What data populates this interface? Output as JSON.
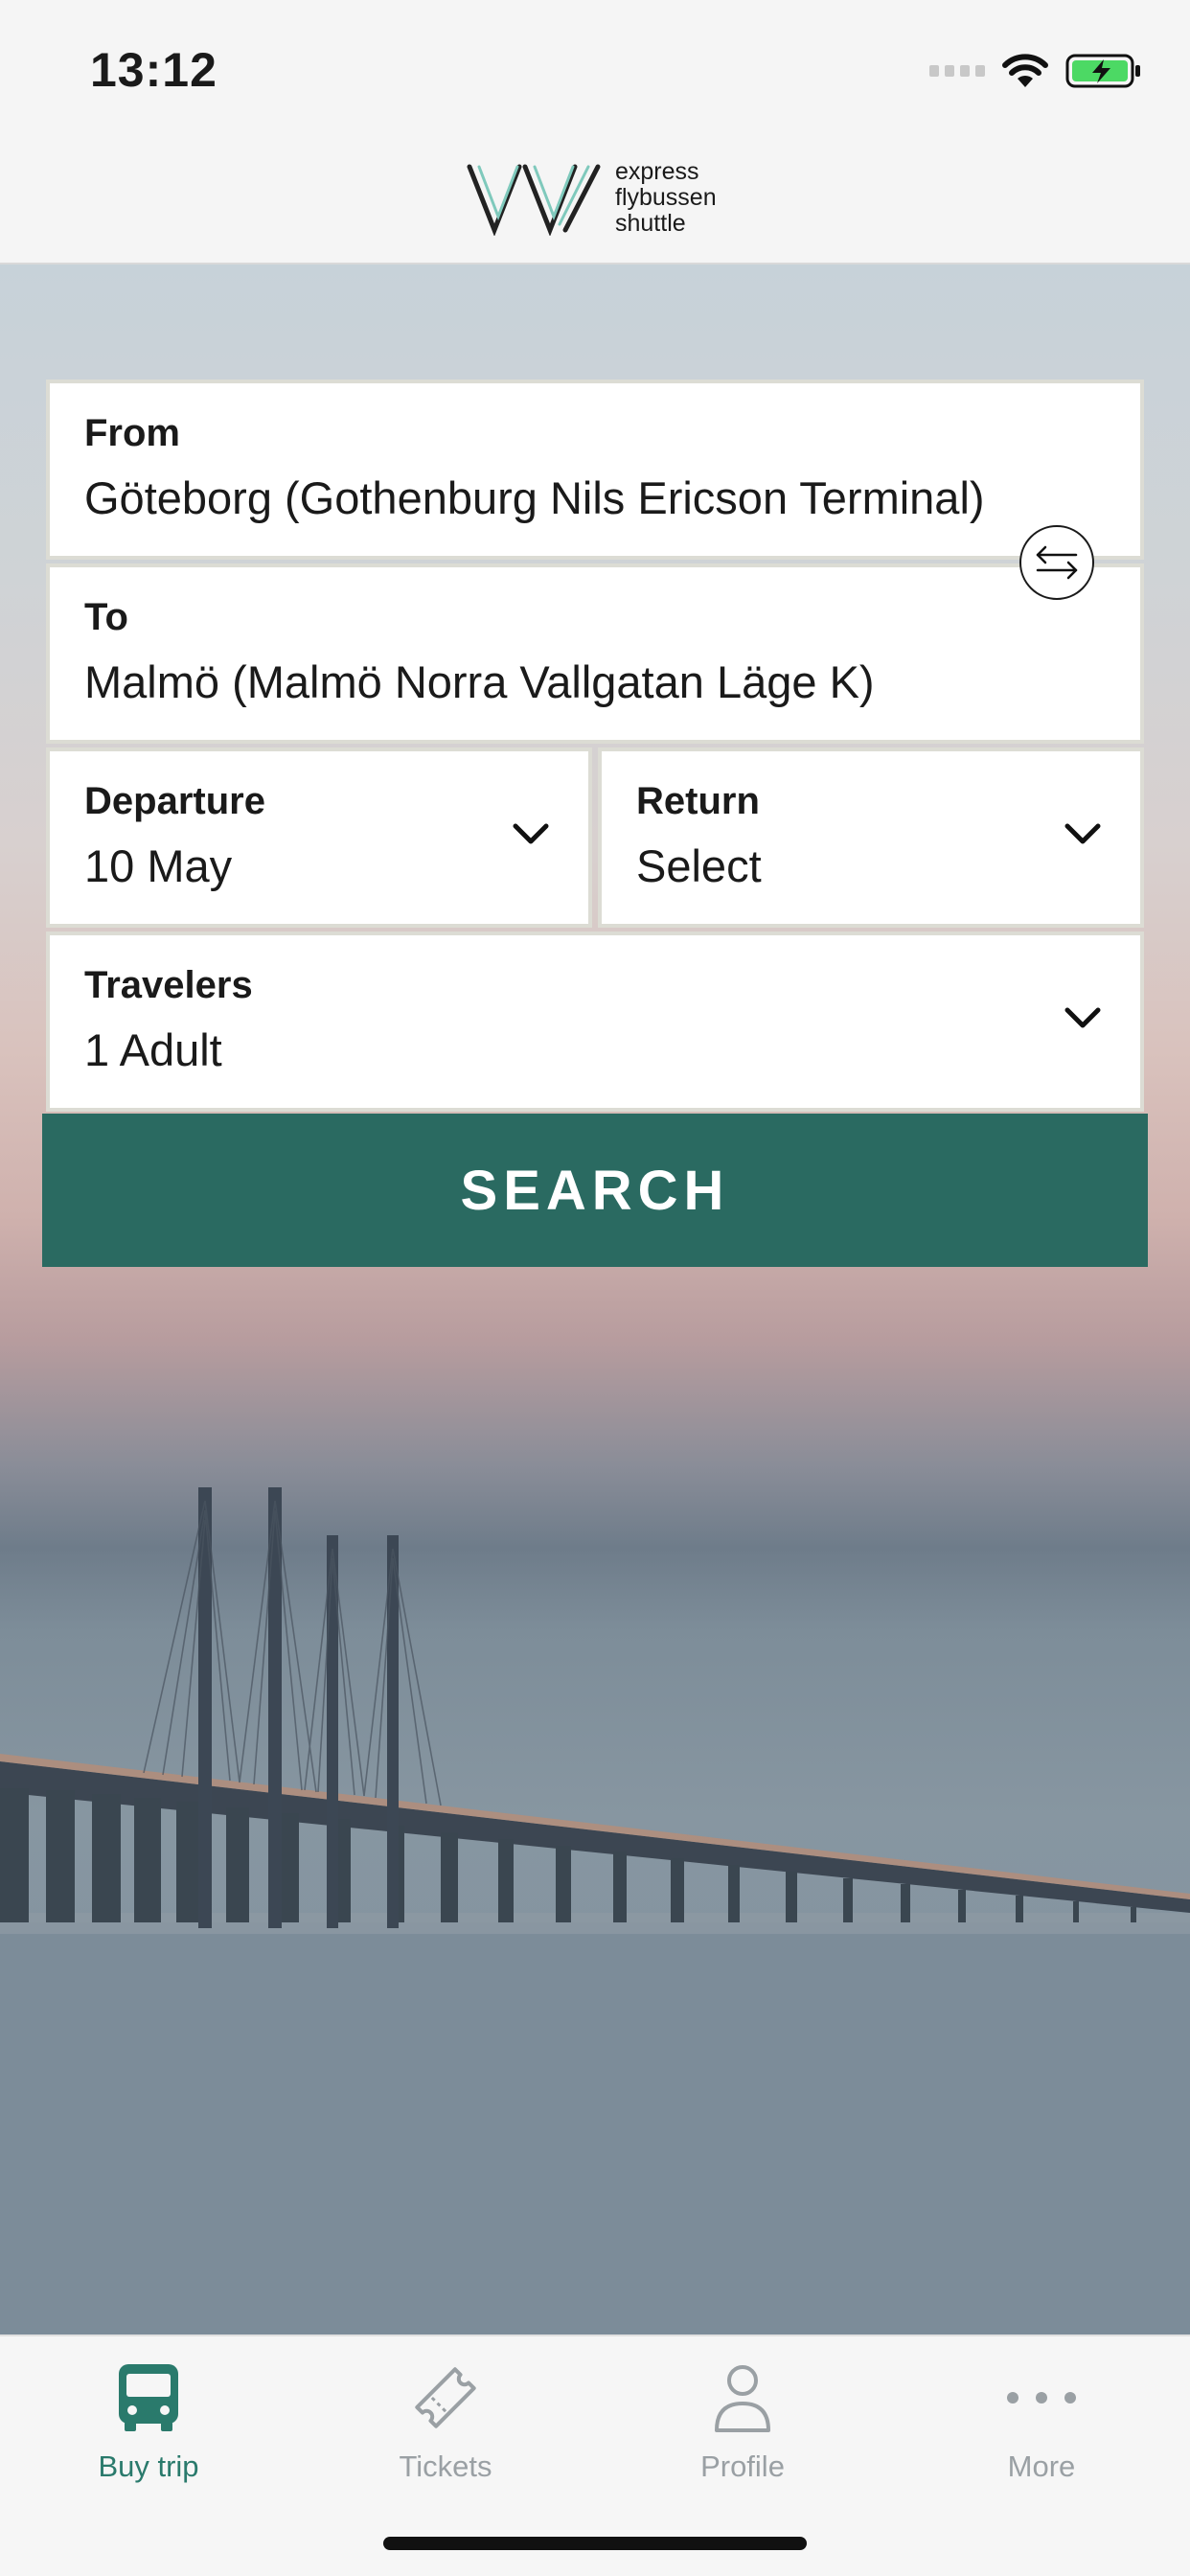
{
  "status": {
    "time": "13:12"
  },
  "brand": {
    "line1": "express",
    "line2": "flybussen",
    "line3": "shuttle"
  },
  "form": {
    "from": {
      "label": "From",
      "value": "Göteborg (Gothenburg Nils Ericson Terminal)"
    },
    "to": {
      "label": "To",
      "value": "Malmö (Malmö Norra Vallgatan Läge K)"
    },
    "departure": {
      "label": "Departure",
      "value": "10 May"
    },
    "return": {
      "label": "Return",
      "value": "Select"
    },
    "travelers": {
      "label": "Travelers",
      "value": "1 Adult"
    },
    "search_label": "SEARCH"
  },
  "tabs": [
    {
      "label": "Buy trip",
      "icon": "bus-icon",
      "active": true
    },
    {
      "label": "Tickets",
      "icon": "ticket-icon",
      "active": false
    },
    {
      "label": "Profile",
      "icon": "profile-icon",
      "active": false
    },
    {
      "label": "More",
      "icon": "more-icon",
      "active": false
    }
  ],
  "colors": {
    "accent": "#2a6a61",
    "active_tab": "#2a7a6c",
    "inactive_tab": "#9aa0a4",
    "battery": "#4cd964"
  }
}
